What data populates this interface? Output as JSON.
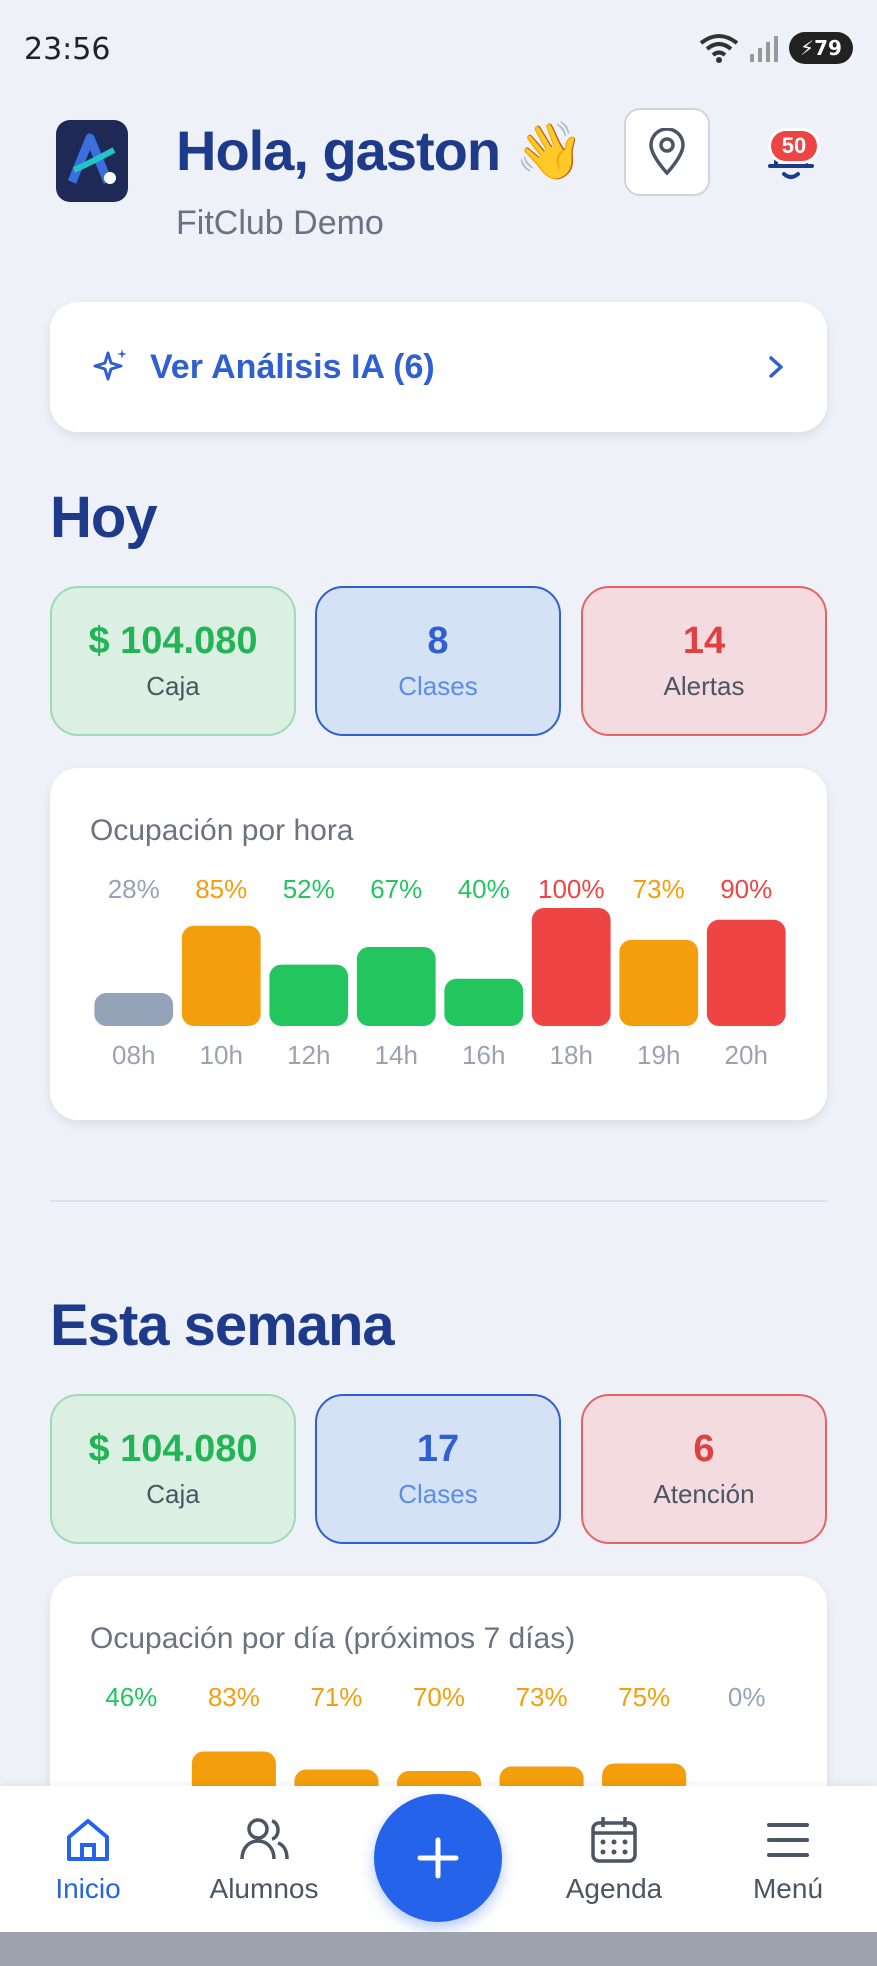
{
  "status": {
    "time": "23:56",
    "battery": "79"
  },
  "header": {
    "greeting": "Hola, gaston",
    "wave_emoji": "👋",
    "subtitle": "FitClub Demo",
    "notif_count": "50"
  },
  "ai": {
    "label": "Ver Análisis IA (6)"
  },
  "today": {
    "title": "Hoy",
    "stats": [
      {
        "value": "$ 104.080",
        "label": "Caja",
        "tone": "green"
      },
      {
        "value": "8",
        "label": "Clases",
        "tone": "blue"
      },
      {
        "value": "14",
        "label": "Alertas",
        "tone": "red"
      }
    ]
  },
  "week": {
    "title": "Esta semana",
    "stats": [
      {
        "value": "$ 104.080",
        "label": "Caja",
        "tone": "green"
      },
      {
        "value": "17",
        "label": "Clases",
        "tone": "blue"
      },
      {
        "value": "6",
        "label": "Atención",
        "tone": "red"
      }
    ]
  },
  "colors": {
    "grey": "#94a3b8",
    "green": "#22c55e",
    "orange": "#f59e0b",
    "red": "#ef4444"
  },
  "chart_data": [
    {
      "type": "bar",
      "title": "Ocupación por hora",
      "categories": [
        "08h",
        "10h",
        "12h",
        "14h",
        "16h",
        "18h",
        "19h",
        "20h"
      ],
      "values": [
        28,
        85,
        52,
        67,
        40,
        100,
        73,
        90
      ],
      "value_labels": [
        "28%",
        "85%",
        "52%",
        "67%",
        "40%",
        "100%",
        "73%",
        "90%"
      ],
      "ylim": [
        0,
        100
      ]
    },
    {
      "type": "bar",
      "title": "Ocupación por día (próximos 7 días)",
      "categories": [],
      "values": [
        46,
        83,
        71,
        70,
        73,
        75,
        0
      ],
      "value_labels": [
        "46%",
        "83%",
        "71%",
        "70%",
        "73%",
        "75%",
        "0%"
      ],
      "ylim": [
        0,
        100
      ]
    }
  ],
  "nav": {
    "items": [
      {
        "label": "Inicio"
      },
      {
        "label": "Alumnos"
      },
      {
        "label": "Agenda"
      },
      {
        "label": "Menú"
      }
    ]
  }
}
